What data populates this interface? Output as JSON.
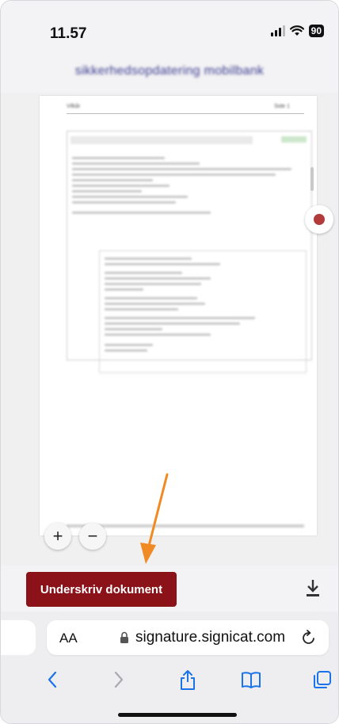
{
  "status_bar": {
    "time": "11.57",
    "battery": "90"
  },
  "page": {
    "heading": "sikkerhedsopdatering mobilbank"
  },
  "document": {
    "header_left": "Vilkår",
    "header_right": "Side 1"
  },
  "zoom": {
    "in_label": "+",
    "out_label": "−"
  },
  "actions": {
    "sign_label": "Underskriv dokument"
  },
  "browser": {
    "text_size_label": "AA",
    "url": "signature.signicat.com"
  },
  "colors": {
    "sign_button": "#8b1219",
    "annotation_arrow": "#f08a24",
    "ios_blue": "#1a73e8"
  },
  "icons": {
    "download": "download-icon",
    "lock": "lock-icon",
    "reload": "reload-icon",
    "back": "chevron-left-icon",
    "forward": "chevron-right-icon",
    "share": "share-icon",
    "bookmarks": "book-icon",
    "tabs": "tabs-icon"
  }
}
